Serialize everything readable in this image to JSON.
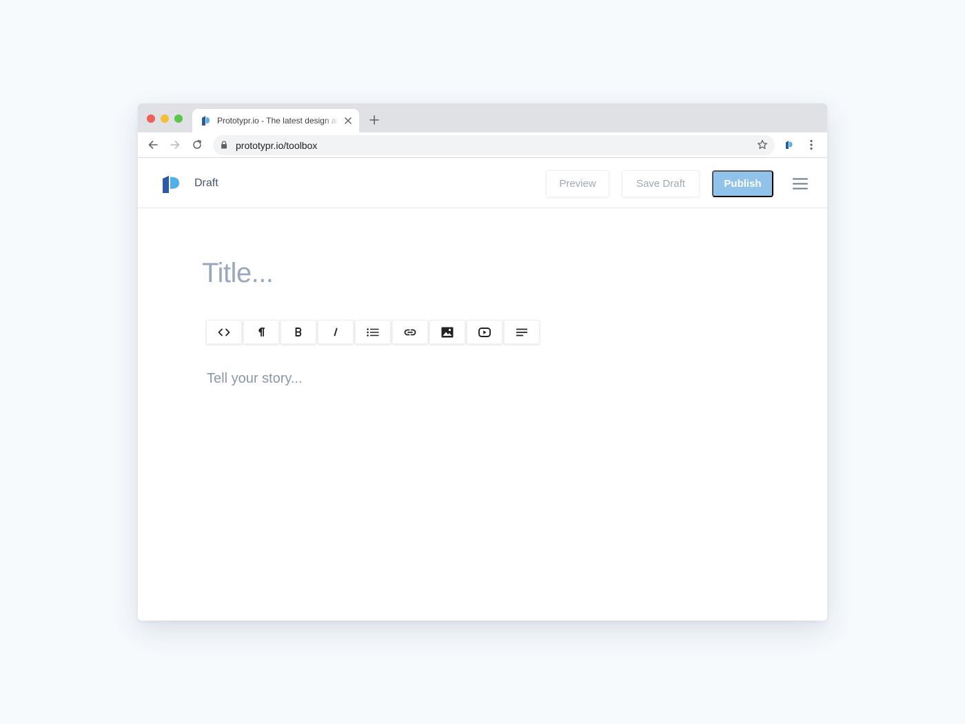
{
  "browser": {
    "tab_title": "Prototypr.io - The latest design and",
    "url": "prototypr.io/toolbox"
  },
  "header": {
    "status_label": "Draft",
    "preview_label": "Preview",
    "save_draft_label": "Save Draft",
    "publish_label": "Publish"
  },
  "editor": {
    "title_placeholder": "Title...",
    "body_placeholder": "Tell your story...",
    "toolbar_icons": [
      "code-icon",
      "paragraph-icon",
      "bold-icon",
      "italic-icon",
      "list-icon",
      "link-icon",
      "image-icon",
      "video-icon",
      "align-left-icon"
    ]
  },
  "colors": {
    "publish_bg": "#90c2ea",
    "logo_dark": "#2c5aa8",
    "logo_light": "#4fb0ea",
    "placeholder": "#99a8bc"
  }
}
